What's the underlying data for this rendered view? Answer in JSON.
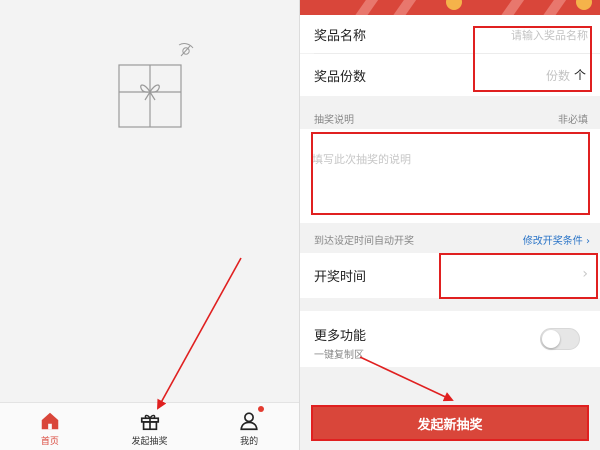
{
  "left": {
    "tabs": [
      {
        "label": "首页",
        "icon": "home-icon",
        "active": true
      },
      {
        "label": "发起抽奖",
        "icon": "gift-icon",
        "active": false
      },
      {
        "label": "我的",
        "icon": "user-icon",
        "active": false
      }
    ]
  },
  "form": {
    "prize_name": {
      "label": "奖品名称",
      "placeholder": "请输入奖品名称"
    },
    "prize_count": {
      "label": "奖品份数",
      "placeholder": "份数",
      "unit": "个"
    },
    "desc": {
      "label": "抽奖说明",
      "optional": "非必填",
      "placeholder": "填写此次抽奖的说明"
    },
    "auto_draw": {
      "label": "到达设定时间自动开奖",
      "link": "修改开奖条件 ›"
    },
    "draw_time": {
      "label": "开奖时间"
    },
    "more": {
      "label": "更多功能",
      "sub": "一键复制区",
      "enabled": false
    },
    "submit": {
      "label": "发起新抽奖"
    }
  },
  "colors": {
    "accent": "#d9463a",
    "link": "#2a74c7",
    "highlight": "#e02020"
  }
}
